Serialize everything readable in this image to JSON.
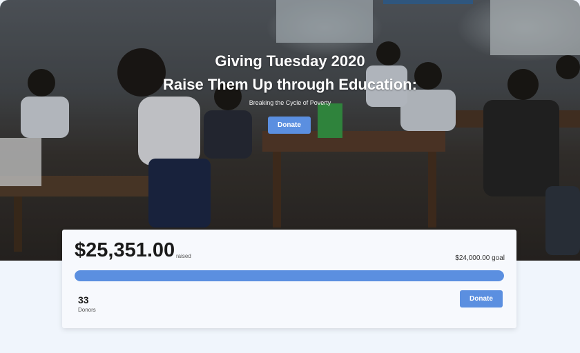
{
  "hero": {
    "title_line1": "Giving Tuesday 2020",
    "title_line2": "Raise Them Up through Education:",
    "subtitle": "Breaking the Cycle of Poverty",
    "donate_label": "Donate"
  },
  "campaign": {
    "raised": "$25,351.00",
    "raised_label": "raised",
    "goal": "$24,000.00 goal",
    "progress_fraction": 1.0,
    "donors_count": "33",
    "donors_label": "Donors",
    "donate_label": "Donate"
  },
  "colors": {
    "accent": "#5b8fe0",
    "page_background": "#f0f5fc"
  }
}
